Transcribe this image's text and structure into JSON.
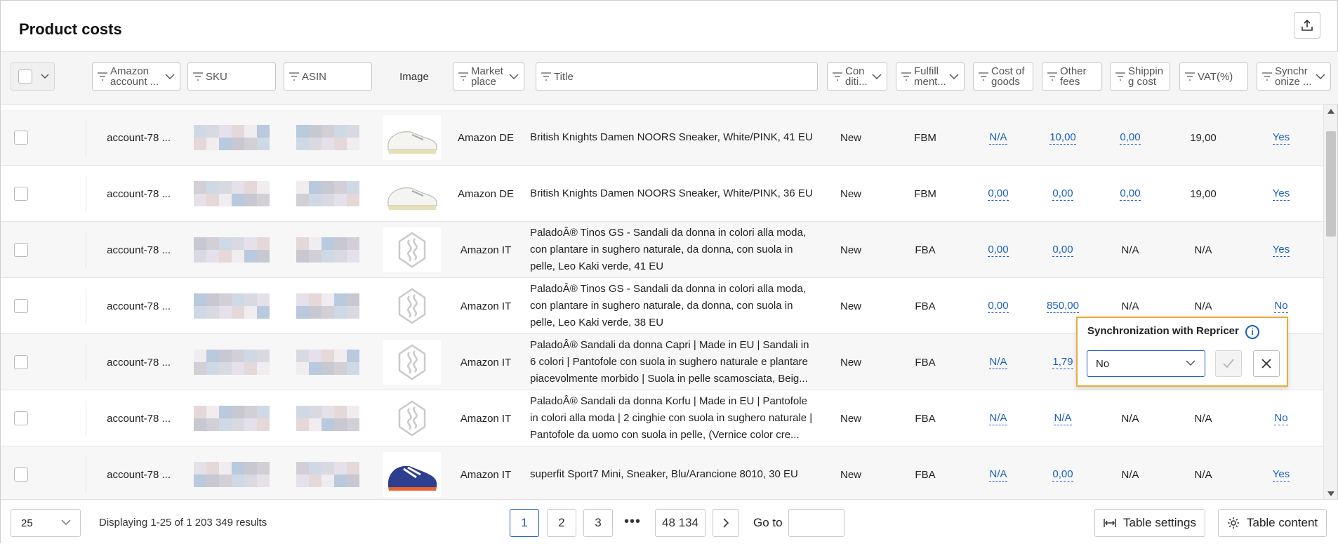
{
  "header": {
    "title": "Product costs"
  },
  "columns": {
    "account": "Amazon account ...",
    "sku": "SKU",
    "asin": "ASIN",
    "image": "Image",
    "marketplace": "Market place",
    "title": "Title",
    "condition": "Con diti...",
    "fulfillment": "Fulfill ment...",
    "cost_of_goods": "Cost of goods",
    "other_fees": "Other fees",
    "shipping_cost": "Shippin g cost",
    "vat": "VAT(%)",
    "synchronize": "Synchr onize ..."
  },
  "rows": [
    {
      "account": "account-78 ...",
      "marketplace": "Amazon DE",
      "title": "British Knights Damen NOORS Sneaker, White/PINK, 41 EU",
      "condition": "New",
      "fulfillment": "FBM",
      "cost_of_goods": "N/A",
      "other_fees": "10,00",
      "shipping_cost": "0,00",
      "vat": "19,00",
      "sync": "Yes",
      "image": "sneaker-white"
    },
    {
      "account": "account-78 ...",
      "marketplace": "Amazon DE",
      "title": "British Knights Damen NOORS Sneaker, White/PINK, 36 EU",
      "condition": "New",
      "fulfillment": "FBM",
      "cost_of_goods": "0,00",
      "other_fees": "0,00",
      "shipping_cost": "0,00",
      "vat": "19,00",
      "sync": "Yes",
      "image": "sneaker-white"
    },
    {
      "account": "account-78 ...",
      "marketplace": "Amazon IT",
      "title": "PaladoÂ® Tinos GS - Sandali da donna in colori alla moda, con plantare in sughero naturale, da donna, con suola in pelle, Leo Kaki verde, 41 EU",
      "condition": "New",
      "fulfillment": "FBA",
      "cost_of_goods": "0,00",
      "other_fees": "0,00",
      "shipping_cost": "N/A",
      "vat": "N/A",
      "sync": "Yes",
      "image": "placeholder"
    },
    {
      "account": "account-78 ...",
      "marketplace": "Amazon IT",
      "title": "PaladoÂ® Tinos GS - Sandali da donna in colori alla moda, con plantare in sughero naturale, da donna, con suola in pelle, Leo Kaki verde, 38 EU",
      "condition": "New",
      "fulfillment": "FBA",
      "cost_of_goods": "0,00",
      "other_fees": "850,00",
      "shipping_cost": "N/A",
      "vat": "N/A",
      "sync": "No",
      "image": "placeholder"
    },
    {
      "account": "account-78 ...",
      "marketplace": "Amazon IT",
      "title": "PaladoÂ® Sandali da donna Capri | Made in EU | Sandali in 6 colori | Pantofole con suola in sughero naturale e plantare piacevolmente morbido | Suola in pelle scamosciata, Beig...",
      "condition": "New",
      "fulfillment": "FBA",
      "cost_of_goods": "N/A",
      "other_fees": "1,79",
      "shipping_cost": "",
      "vat": "",
      "sync": "",
      "image": "placeholder"
    },
    {
      "account": "account-78 ...",
      "marketplace": "Amazon IT",
      "title": "PaladoÂ® Sandali da donna Korfu | Made in EU | Pantofole in colori alla moda | 2 cinghie con suola in sughero naturale | Pantofole da uomo con suola in pelle, (Vernice color cre...",
      "condition": "New",
      "fulfillment": "FBA",
      "cost_of_goods": "N/A",
      "other_fees": "N/A",
      "shipping_cost": "N/A",
      "vat": "N/A",
      "sync": "No",
      "image": "placeholder"
    },
    {
      "account": "account-78 ...",
      "marketplace": "Amazon IT",
      "title": "superfit Sport7 Mini, Sneaker, Blu/Arancione 8010, 30 EU",
      "condition": "New",
      "fulfillment": "FBA",
      "cost_of_goods": "N/A",
      "other_fees": "0,00",
      "shipping_cost": "N/A",
      "vat": "N/A",
      "sync": "Yes",
      "image": "sneaker-blue"
    }
  ],
  "popup": {
    "title": "Synchronization with Repricer",
    "selected": "No"
  },
  "footer": {
    "page_size": "25",
    "displaying": "Displaying 1-25 of 1 203 349 results",
    "pages": [
      "1",
      "2",
      "3"
    ],
    "ellipsis": "•••",
    "last_page": "48 134",
    "goto_label": "Go to",
    "table_settings": "Table settings",
    "table_content": "Table content"
  },
  "colors": {
    "accent": "#1a5fc2",
    "highlight": "#e8ad3a"
  }
}
